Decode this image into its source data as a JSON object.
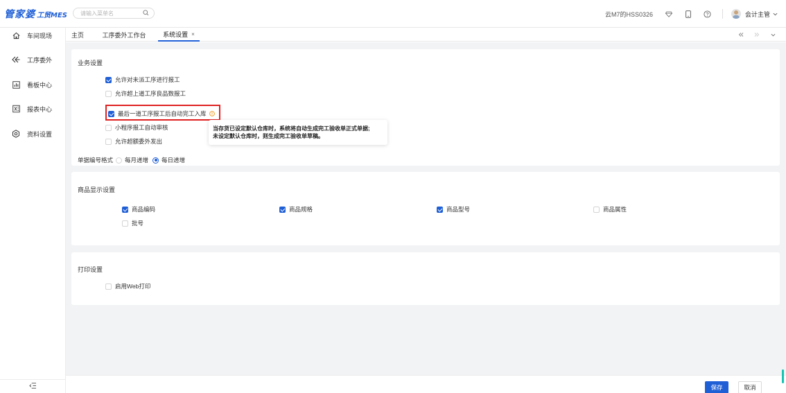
{
  "brand": {
    "main": "管家婆",
    "sub": "工贸MES"
  },
  "search": {
    "placeholder": "请输入菜单名"
  },
  "header": {
    "tenant": "云M7的HSS0326",
    "user": "会计主管"
  },
  "sidebar": {
    "items": [
      {
        "label": "车间现场",
        "icon": "home-icon"
      },
      {
        "label": "工序委外",
        "icon": "outsource-icon"
      },
      {
        "label": "看板中心",
        "icon": "chart-board-icon"
      },
      {
        "label": "报表中心",
        "icon": "excel-report-icon"
      },
      {
        "label": "资料设置",
        "icon": "settings-gear-icon"
      }
    ],
    "collapse_icon": "collapse-menu-icon"
  },
  "tabs": [
    {
      "label": "主页",
      "active": false
    },
    {
      "label": "工序委外工作台",
      "active": false
    },
    {
      "label": "系统设置",
      "active": true,
      "close": "×"
    }
  ],
  "business": {
    "title": "业务设置",
    "options": [
      {
        "label": "允许对未派工序进行报工",
        "checked": true
      },
      {
        "label": "允许超上道工序良品数报工",
        "checked": false
      },
      {
        "label": "最后一道工序报工后自动完工入库",
        "checked": true
      },
      {
        "label": "小程序报工自动审核",
        "checked": false
      },
      {
        "label": "允许超额委外发出",
        "checked": false
      }
    ],
    "tooltip": [
      "当存货已设定默认仓库时，系统将自动生成完工验收单正式单据;",
      "未设定默认仓库时，则生成完工验收单草稿。"
    ],
    "numbering": {
      "label": "单据编号格式",
      "options": [
        {
          "label": "每月递增",
          "checked": false
        },
        {
          "label": "每日递增",
          "checked": true
        }
      ]
    }
  },
  "product": {
    "title": "商品显示设置",
    "options": [
      {
        "label": "商品编码",
        "checked": true
      },
      {
        "label": "商品规格",
        "checked": true
      },
      {
        "label": "商品型号",
        "checked": true
      },
      {
        "label": "商品属性",
        "checked": false
      },
      {
        "label": "批号",
        "checked": false
      }
    ]
  },
  "print": {
    "title": "打印设置",
    "options": [
      {
        "label": "启用Web打印",
        "checked": false
      }
    ]
  },
  "footer": {
    "save": "保存",
    "cancel": "取消"
  },
  "colors": {
    "accent": "#1f5fd6",
    "highlight": "#e02020",
    "warning": "#f08c00",
    "background": "#f2f3f5"
  }
}
